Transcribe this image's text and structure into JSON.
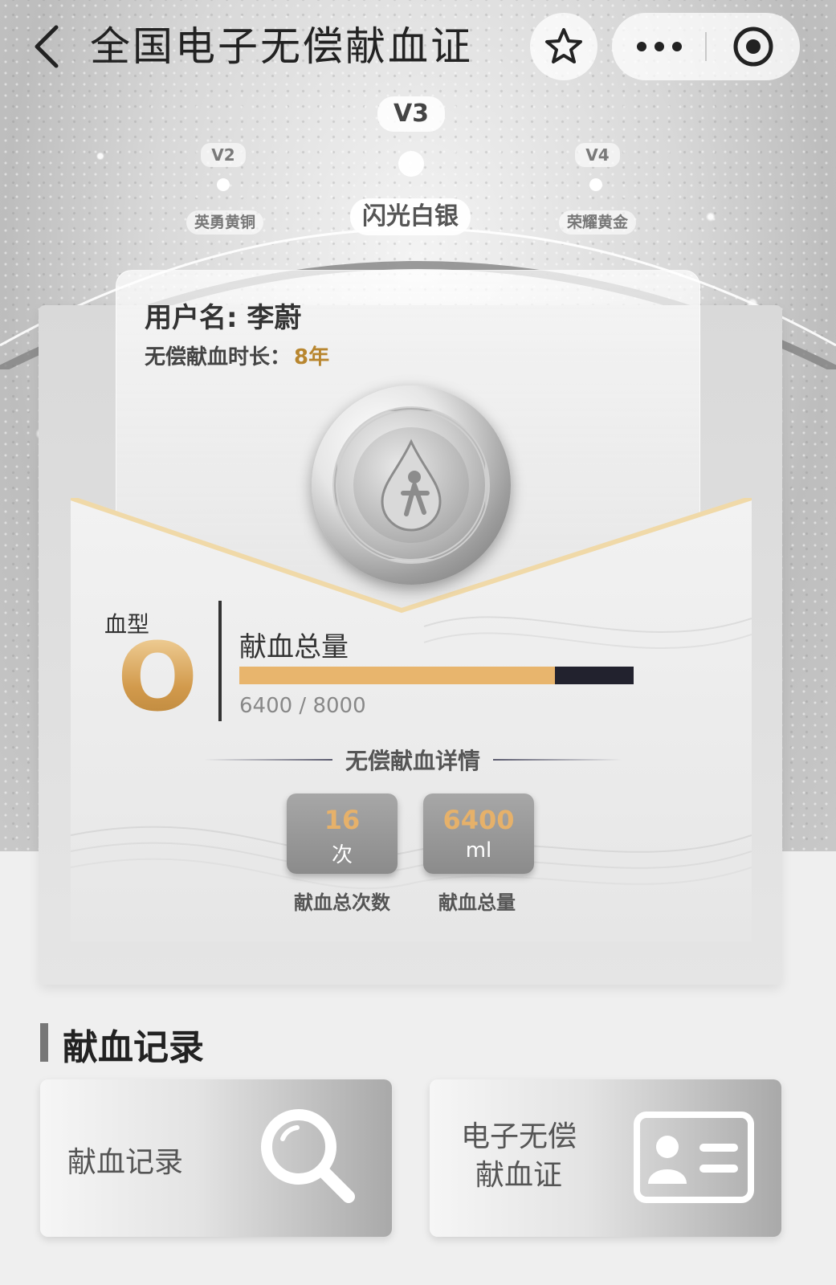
{
  "nav": {
    "title": "全国电子无偿献血证",
    "back_icon": "chevron-left-icon",
    "favorite_icon": "star-icon",
    "more_icon": "more-dots-icon",
    "close_icon": "target-circle-icon"
  },
  "levels": {
    "current": "V3",
    "prev": "V2",
    "next": "V4",
    "current_name": "闪光白银",
    "prev_name": "英勇黄铜",
    "next_name": "荣耀黄金"
  },
  "user": {
    "username_label": "用户名: 李蔚",
    "duration_label": "无偿献血时长：",
    "duration_value": "8年"
  },
  "blood": {
    "type_label": "血型",
    "type_value": "O",
    "total_label": "献血总量",
    "progress_text": "6400 / 8000",
    "progress_fraction": 0.8,
    "progress_color": "#e8b56d",
    "track_color": "#22222e"
  },
  "details": {
    "title": "无偿献血详情",
    "count_value": "16",
    "count_unit": "次",
    "count_caption": "献血总次数",
    "volume_value": "6400",
    "volume_unit": "ml",
    "volume_caption": "献血总量"
  },
  "records": {
    "section_title": "献血记录",
    "tile1_label": "献血记录",
    "tile1_icon": "search-icon",
    "tile2_label": "电子无偿献血证",
    "tile2_icon": "id-card-icon"
  }
}
